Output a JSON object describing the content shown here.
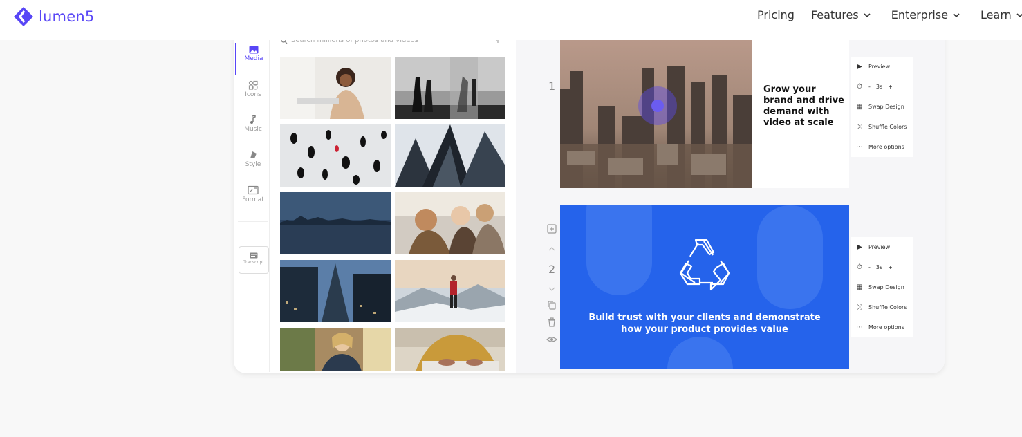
{
  "brand": {
    "name": "lumen5",
    "color": "#5846f6"
  },
  "nav": {
    "items": [
      {
        "label": "Pricing",
        "dropdown": false
      },
      {
        "label": "Features",
        "dropdown": true
      },
      {
        "label": "Enterprise",
        "dropdown": true
      },
      {
        "label": "Learn",
        "dropdown": true
      }
    ]
  },
  "editor": {
    "tools": [
      {
        "label": "Media",
        "icon": "image-icon",
        "active": true
      },
      {
        "label": "Icons",
        "icon": "shapes-icon",
        "active": false
      },
      {
        "label": "Music",
        "icon": "music-note-icon",
        "active": false
      },
      {
        "label": "Style",
        "icon": "palette-icon",
        "active": false
      },
      {
        "label": "Format",
        "icon": "aspect-ratio-icon",
        "active": false
      }
    ],
    "transcript_label": "Transcript",
    "search_placeholder": "Search millions of photos and videos",
    "slides": [
      {
        "number": "1",
        "text": "Grow your brand and drive demand with video at scale",
        "options": {
          "preview": "Preview",
          "duration": "3s",
          "minus": "-",
          "plus": "+",
          "swap": "Swap Design",
          "shuffle": "Shuffle Colors",
          "more": "More options"
        }
      },
      {
        "number": "2",
        "text": "Build trust with your clients and demonstrate how your product provides value",
        "options": {
          "preview": "Preview",
          "duration": "3s",
          "minus": "-",
          "plus": "+",
          "swap": "Swap Design",
          "shuffle": "Shuffle Colors",
          "more": "More options"
        }
      }
    ],
    "accent_blue": "#2563eb"
  }
}
